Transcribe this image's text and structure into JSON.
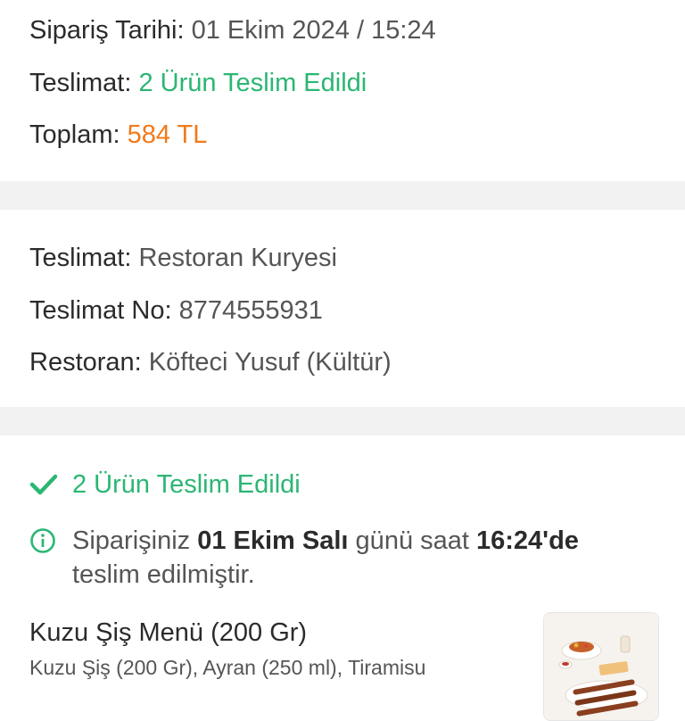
{
  "summary": {
    "order_date_label": "Sipariş Tarihi:",
    "order_date_value": "01 Ekim 2024 / 15:24",
    "delivery_label": "Teslimat:",
    "delivery_value": "2 Ürün Teslim Edildi",
    "total_label": "Toplam:",
    "total_value": "584 TL"
  },
  "delivery_info": {
    "method_label": "Teslimat:",
    "method_value": "Restoran Kuryesi",
    "number_label": "Teslimat No:",
    "number_value": "8774555931",
    "restaurant_label": "Restoran:",
    "restaurant_value": "Köfteci Yusuf (Kültür)"
  },
  "status": {
    "title": "2 Ürün Teslim Edildi",
    "icon": "check-icon",
    "info_icon": "info-icon",
    "info_prefix": "Siparişiniz ",
    "info_date": "01 Ekim Salı",
    "info_middle": " günü saat ",
    "info_time": "16:24'de",
    "info_suffix": " teslim edilmiştir."
  },
  "product": {
    "name": "Kuzu Şiş Menü (200 Gr)",
    "description": "Kuzu Şiş (200 Gr), Ayran (250 ml), Tiramisu",
    "image": "food-photo"
  },
  "colors": {
    "green": "#2bb673",
    "orange": "#f27a1a",
    "separator": "#f2f2f2"
  }
}
